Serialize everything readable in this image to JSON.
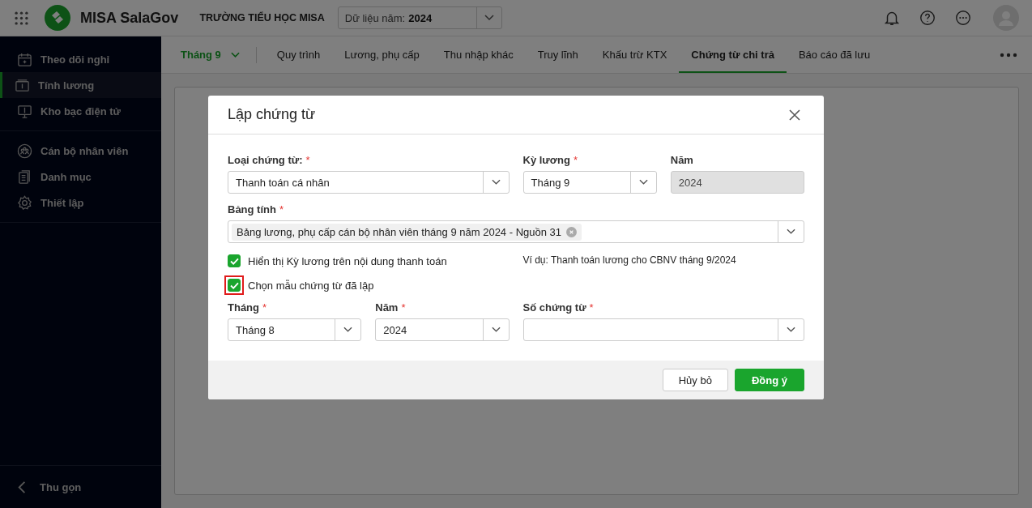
{
  "header": {
    "app_name": "MISA SalaGov",
    "school": "TRƯỜNG TIỂU HỌC MISA",
    "year_select": {
      "label": "Dữ liệu năm:",
      "value": "2024"
    }
  },
  "sidebar": {
    "sections": [
      [
        {
          "label": "Theo dõi nghỉ",
          "selected": false
        },
        {
          "label": "Tính lương",
          "selected": true
        },
        {
          "label": "Kho bạc điện tử",
          "selected": false
        }
      ],
      [
        {
          "label": "Cán bộ nhân viên",
          "selected": false
        },
        {
          "label": "Danh mục",
          "selected": false
        },
        {
          "label": "Thiết lập",
          "selected": false
        }
      ]
    ],
    "collapse_label": "Thu gọn"
  },
  "tabbar": {
    "month": "Tháng 9",
    "tabs": [
      {
        "label": "Quy trình",
        "selected": false
      },
      {
        "label": "Lương, phụ cấp",
        "selected": false
      },
      {
        "label": "Thu nhập khác",
        "selected": false
      },
      {
        "label": "Truy lĩnh",
        "selected": false
      },
      {
        "label": "Khấu trừ KTX",
        "selected": false
      },
      {
        "label": "Chứng từ chi trả",
        "selected": true
      },
      {
        "label": "Báo cáo đã lưu",
        "selected": false
      }
    ]
  },
  "dialog": {
    "title": "Lập chứng từ",
    "fields": [
      {
        "kind": "select",
        "label": "Loại chứng từ:",
        "required_mark": "*",
        "value": "Thanh toán cá nhân"
      },
      {
        "kind": "select",
        "label": "Kỳ lương",
        "required_mark": "*",
        "value": "Tháng 9"
      },
      {
        "kind": "readonly",
        "label": "Năm",
        "value": "2024"
      },
      {
        "kind": "tags",
        "label": "Bảng tính",
        "required_mark": "*",
        "tags": [
          "Bảng lương, phụ cấp cán bộ nhân viên tháng 9 năm 2024 - Nguồn 31"
        ]
      },
      {
        "kind": "checkbox",
        "label": "Hiển thị Kỳ lương trên nội dung thanh toán",
        "checked": true
      },
      {
        "kind": "note",
        "text": "Ví dụ: Thanh toán lương cho CBNV tháng 9/2024"
      },
      {
        "kind": "checkbox",
        "label": "Chọn mẫu chứng từ đã lập",
        "checked": true,
        "highlighted": true
      },
      {
        "kind": "select",
        "label": "Tháng",
        "required_mark": "*",
        "value": "Tháng 8"
      },
      {
        "kind": "select",
        "label": "Năm",
        "required_mark": "*",
        "value": "2024"
      },
      {
        "kind": "select",
        "label": "Số chứng từ",
        "required_mark": "*"
      }
    ],
    "buttons": {
      "cancel": "Hủy bỏ",
      "ok": "Đồng ý"
    }
  }
}
